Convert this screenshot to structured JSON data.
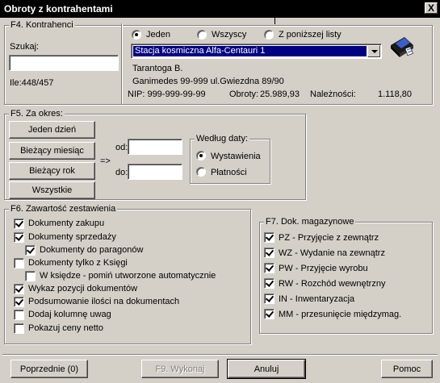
{
  "window": {
    "title": "Obroty z kontrahentami",
    "close_glyph": "X"
  },
  "contractors": {
    "group_title": "F4. Kontrahenci",
    "search_label": "Szukaj:",
    "search_value": "",
    "count_label": "Ile:448/457",
    "scope_options": [
      "Jeden",
      "Wszyscy",
      "Z poniższej listy"
    ],
    "scope_selected": 0,
    "selected_contractor": "Stacja kosmiczna Alfa-Centauri 1",
    "name": "Tarantoga B.",
    "address": "Ganimedes 99-999  ul.Gwiezdna 89/90",
    "nip": "NIP: 999-999-99-99",
    "turnover_label": "Obroty:",
    "turnover_value": "25.989,93",
    "receivables_label": "Należności:",
    "receivables_value": "1.118,80"
  },
  "period": {
    "group_title": "F5. Za okres:",
    "buttons": [
      "Jeden dzień",
      "Bieżący miesiąc",
      "Bieżący rok",
      "Wszystkie"
    ],
    "arrow": "=>",
    "from_label": "od:",
    "to_label": "do:",
    "from_value": "",
    "to_value": "",
    "by_date_title": "Według daty:",
    "date_options": [
      "Wystawienia",
      "Płatności"
    ],
    "date_selected": 0
  },
  "content": {
    "group_title": "F6. Zawartość zestawienia",
    "items": [
      {
        "label": "Dokumenty zakupu",
        "checked": true
      },
      {
        "label": "Dokumenty sprzedaży",
        "checked": true
      },
      {
        "label": "Dokumenty do paragonów",
        "checked": true
      },
      {
        "label": "Dokumenty tylko z Księgi",
        "checked": false
      },
      {
        "label": "W księdze - pomiń utworzone automatycznie",
        "checked": false
      },
      {
        "label": "Wykaz pozycji dokumentów",
        "checked": true
      },
      {
        "label": "Podsumowanie ilości na dokumentach",
        "checked": true
      },
      {
        "label": "Dodaj kolumnę uwag",
        "checked": false
      },
      {
        "label": "Pokazuj ceny netto",
        "checked": false
      }
    ]
  },
  "warehouse": {
    "group_title": "F7. Dok. magazynowe",
    "items": [
      {
        "label": "PZ - Przyjęcie z zewnątrz",
        "checked": true
      },
      {
        "label": "WZ - Wydanie na zewnątrz",
        "checked": true
      },
      {
        "label": "PW - Przyjęcie wyrobu",
        "checked": true
      },
      {
        "label": "RW - Rozchód wewnętrzny",
        "checked": true
      },
      {
        "label": "IN - Inwentaryzacja",
        "checked": true
      },
      {
        "label": "MM - przesunięcie międzymag.",
        "checked": true
      }
    ]
  },
  "footer": {
    "previous": "Poprzednie (0)",
    "execute": "F9. Wykonaj",
    "cancel": "Anuluj",
    "help": "Pomoc"
  },
  "icons": {
    "contractor_card": "address-card-icon"
  }
}
